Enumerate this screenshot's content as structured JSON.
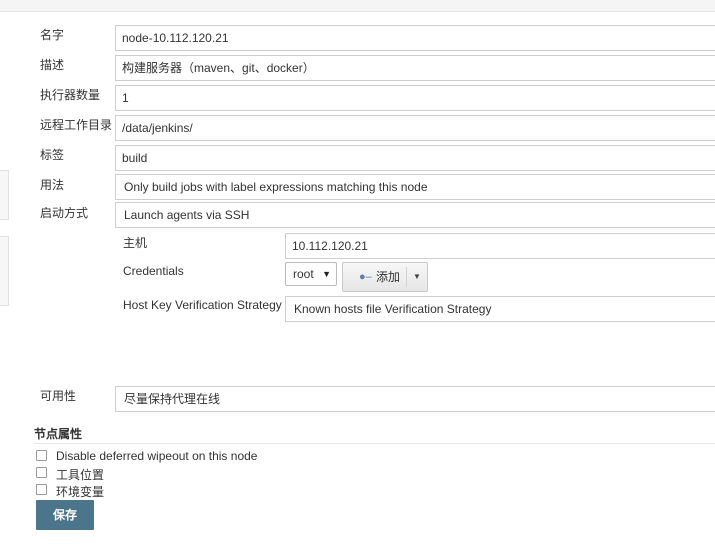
{
  "form": {
    "name": {
      "label": "名字",
      "value": "node-10.112.120.21"
    },
    "description": {
      "label": "描述",
      "value": "构建服务器（maven、git、docker）"
    },
    "executors": {
      "label": "执行器数量",
      "value": "1"
    },
    "remote_dir": {
      "label": "远程工作目录",
      "value": "/data/jenkins/"
    },
    "labels": {
      "label": "标签",
      "value": "build"
    },
    "usage": {
      "label": "用法",
      "value": "Only build jobs with label expressions matching this node"
    },
    "launch": {
      "label": "启动方式",
      "value": "Launch agents via SSH"
    },
    "host": {
      "label": "主机",
      "value": "10.112.120.21"
    },
    "credentials": {
      "label": "Credentials",
      "value": "root",
      "add_label": "添加"
    },
    "host_key": {
      "label": "Host Key Verification Strategy",
      "value": "Known hosts file Verification Strategy"
    },
    "availability": {
      "label": "可用性",
      "value": "尽量保持代理在线"
    }
  },
  "node_properties": {
    "title": "节点属性",
    "options": [
      {
        "label": "Disable deferred wipeout on this node",
        "checked": false
      },
      {
        "label": "工具位置",
        "checked": false
      },
      {
        "label": "环境变量",
        "checked": false
      }
    ]
  },
  "save_label": "保存",
  "icons": {
    "credentials_add": "key-icon",
    "dropdown": "caret-down-icon"
  }
}
